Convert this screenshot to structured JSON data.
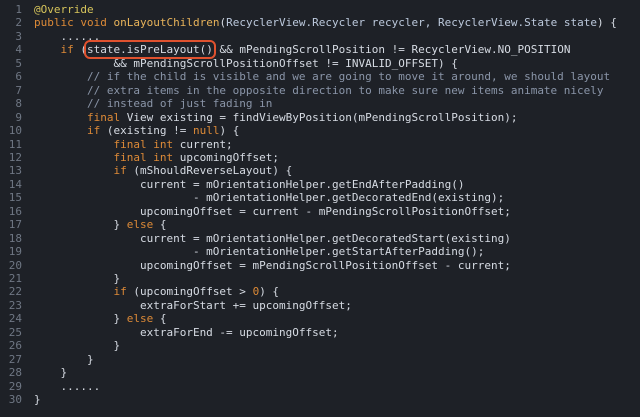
{
  "editor": {
    "lines": [
      {
        "n": "1",
        "tokens": [
          {
            "k": "ann",
            "t": "@Override"
          }
        ]
      },
      {
        "n": "2",
        "tokens": [
          {
            "k": "kw",
            "t": "public void "
          },
          {
            "k": "fn",
            "t": "onLayoutChildren"
          },
          {
            "k": "plain",
            "t": "("
          },
          {
            "k": "type",
            "t": "RecyclerView.Recycler recycler, RecyclerView.State state"
          },
          {
            "k": "plain",
            "t": ") {"
          }
        ]
      },
      {
        "n": "3",
        "tokens": [
          {
            "k": "dots",
            "t": "    ......"
          }
        ]
      },
      {
        "n": "4",
        "tokens": [
          {
            "k": "kw",
            "t": "    if "
          },
          {
            "k": "plain",
            "t": "("
          },
          {
            "k": "hl",
            "t": "state.isPreLayout()"
          },
          {
            "k": "plain",
            "t": " && mPendingScrollPosition != RecyclerView.NO_POSITION"
          }
        ]
      },
      {
        "n": "5",
        "tokens": [
          {
            "k": "plain",
            "t": "            && mPendingScrollPositionOffset != INVALID_OFFSET) {"
          }
        ]
      },
      {
        "n": "6",
        "tokens": [
          {
            "k": "cmt",
            "t": "        // if the child is visible and we are going to move it around, we should layout"
          }
        ]
      },
      {
        "n": "7",
        "tokens": [
          {
            "k": "cmt",
            "t": "        // extra items in the opposite direction to make sure new items animate nicely"
          }
        ]
      },
      {
        "n": "8",
        "tokens": [
          {
            "k": "cmt",
            "t": "        // instead of just fading in"
          }
        ]
      },
      {
        "n": "9",
        "tokens": [
          {
            "k": "kw",
            "t": "        final "
          },
          {
            "k": "plain",
            "t": "View existing = findViewByPosition(mPendingScrollPosition);"
          }
        ]
      },
      {
        "n": "10",
        "tokens": [
          {
            "k": "kw",
            "t": "        if "
          },
          {
            "k": "plain",
            "t": "(existing != "
          },
          {
            "k": "kw",
            "t": "null"
          },
          {
            "k": "plain",
            "t": ") {"
          }
        ]
      },
      {
        "n": "11",
        "tokens": [
          {
            "k": "kw",
            "t": "            final int "
          },
          {
            "k": "plain",
            "t": "current;"
          }
        ]
      },
      {
        "n": "12",
        "tokens": [
          {
            "k": "kw",
            "t": "            final int "
          },
          {
            "k": "plain",
            "t": "upcomingOffset;"
          }
        ]
      },
      {
        "n": "13",
        "tokens": [
          {
            "k": "kw",
            "t": "            if "
          },
          {
            "k": "plain",
            "t": "(mShouldReverseLayout) {"
          }
        ]
      },
      {
        "n": "14",
        "tokens": [
          {
            "k": "plain",
            "t": "                current = mOrientationHelper.getEndAfterPadding()"
          }
        ]
      },
      {
        "n": "15",
        "tokens": [
          {
            "k": "plain",
            "t": "                        - mOrientationHelper.getDecoratedEnd(existing);"
          }
        ]
      },
      {
        "n": "16",
        "tokens": [
          {
            "k": "plain",
            "t": "                upcomingOffset = current - mPendingScrollPositionOffset;"
          }
        ]
      },
      {
        "n": "17",
        "tokens": [
          {
            "k": "plain",
            "t": "            } "
          },
          {
            "k": "kw",
            "t": "else "
          },
          {
            "k": "plain",
            "t": "{"
          }
        ]
      },
      {
        "n": "18",
        "tokens": [
          {
            "k": "plain",
            "t": "                current = mOrientationHelper.getDecoratedStart(existing)"
          }
        ]
      },
      {
        "n": "19",
        "tokens": [
          {
            "k": "plain",
            "t": "                        - mOrientationHelper.getStartAfterPadding();"
          }
        ]
      },
      {
        "n": "20",
        "tokens": [
          {
            "k": "plain",
            "t": "                upcomingOffset = mPendingScrollPositionOffset - current;"
          }
        ]
      },
      {
        "n": "21",
        "tokens": [
          {
            "k": "plain",
            "t": "            }"
          }
        ]
      },
      {
        "n": "22",
        "tokens": [
          {
            "k": "kw",
            "t": "            if "
          },
          {
            "k": "plain",
            "t": "(upcomingOffset > "
          },
          {
            "k": "num",
            "t": "0"
          },
          {
            "k": "plain",
            "t": ") {"
          }
        ]
      },
      {
        "n": "23",
        "tokens": [
          {
            "k": "plain",
            "t": "                extraForStart += upcomingOffset;"
          }
        ]
      },
      {
        "n": "24",
        "tokens": [
          {
            "k": "plain",
            "t": "            } "
          },
          {
            "k": "kw",
            "t": "else "
          },
          {
            "k": "plain",
            "t": "{"
          }
        ]
      },
      {
        "n": "25",
        "tokens": [
          {
            "k": "plain",
            "t": "                extraForEnd -= upcomingOffset;"
          }
        ]
      },
      {
        "n": "26",
        "tokens": [
          {
            "k": "plain",
            "t": "            }"
          }
        ]
      },
      {
        "n": "27",
        "tokens": [
          {
            "k": "plain",
            "t": "        }"
          }
        ]
      },
      {
        "n": "28",
        "tokens": [
          {
            "k": "plain",
            "t": "    }"
          }
        ]
      },
      {
        "n": "29",
        "tokens": [
          {
            "k": "dots",
            "t": "    ......"
          }
        ]
      },
      {
        "n": "30",
        "tokens": [
          {
            "k": "plain",
            "t": "}"
          }
        ]
      }
    ]
  },
  "colors": {
    "background": "#1e2127",
    "highlight_outline": "#e0522f",
    "keyword": "#dd8a37",
    "comment": "#8a95a8"
  }
}
